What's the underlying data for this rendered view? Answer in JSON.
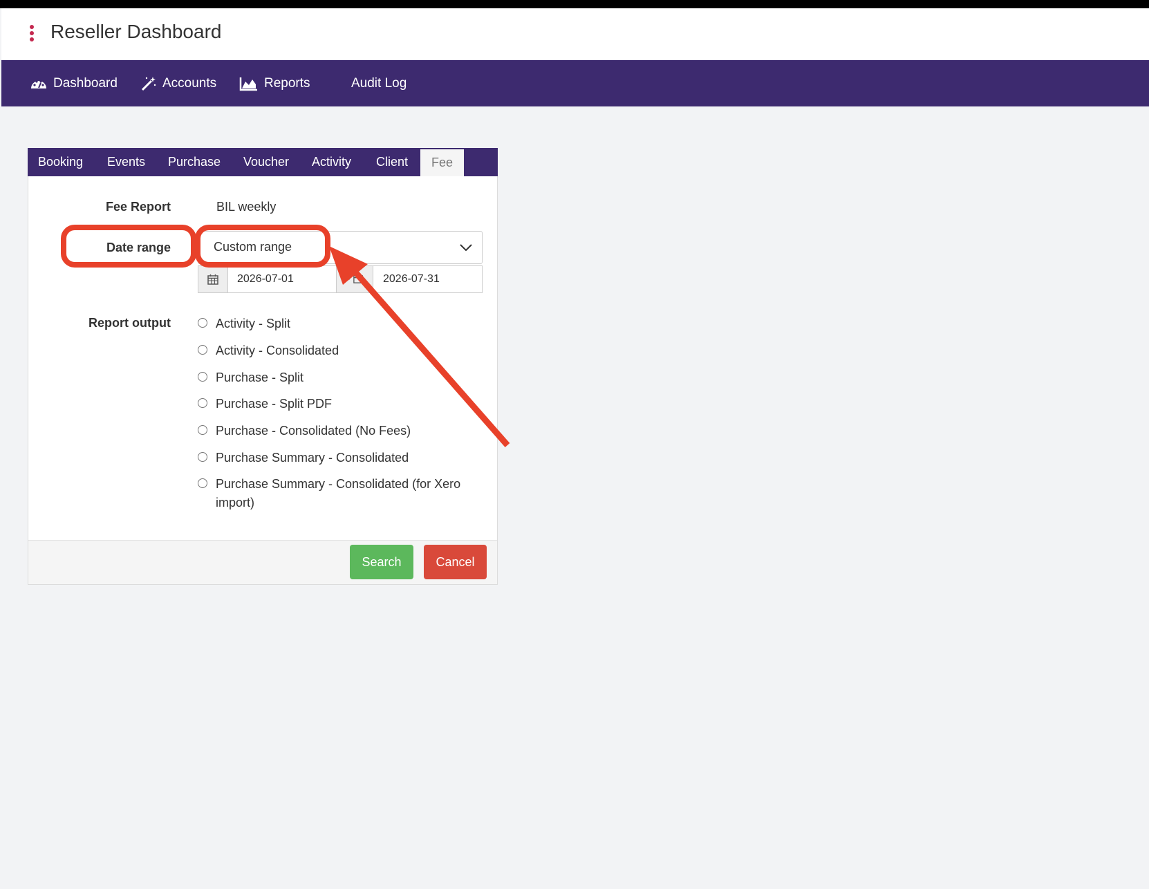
{
  "header": {
    "title": "Reseller Dashboard",
    "menu_icon": "kebab-menu-icon"
  },
  "nav": {
    "items": [
      {
        "label": "Dashboard",
        "icon": "dashboard-gauge-icon"
      },
      {
        "label": "Accounts",
        "icon": "magic-wand-icon"
      },
      {
        "label": "Reports",
        "icon": "area-chart-icon"
      },
      {
        "label": "Audit Log"
      }
    ]
  },
  "tabs": [
    "Booking",
    "Events",
    "Purchase",
    "Voucher",
    "Activity",
    "Client",
    "Fee"
  ],
  "active_tab": "Fee",
  "form": {
    "fee_report_label": "Fee Report",
    "fee_report_value": "BIL weekly",
    "date_range_label": "Date range",
    "date_range_value": "Custom range",
    "start_date": "2026-07-01",
    "separator": "-",
    "end_date": "2026-07-31",
    "report_output_label": "Report output",
    "report_outputs": [
      "Activity - Split",
      "Activity - Consolidated",
      "Purchase - Split",
      "Purchase - Split PDF",
      "Purchase - Consolidated (No Fees)",
      "Purchase Summary - Consolidated",
      "Purchase Summary - Consolidated (for Xero import)"
    ]
  },
  "buttons": {
    "search": "Search",
    "cancel": "Cancel"
  },
  "colors": {
    "brand": "#3d2a6f",
    "search": "#5cb85c",
    "cancel": "#d9493a",
    "annotation": "#e8412a"
  }
}
